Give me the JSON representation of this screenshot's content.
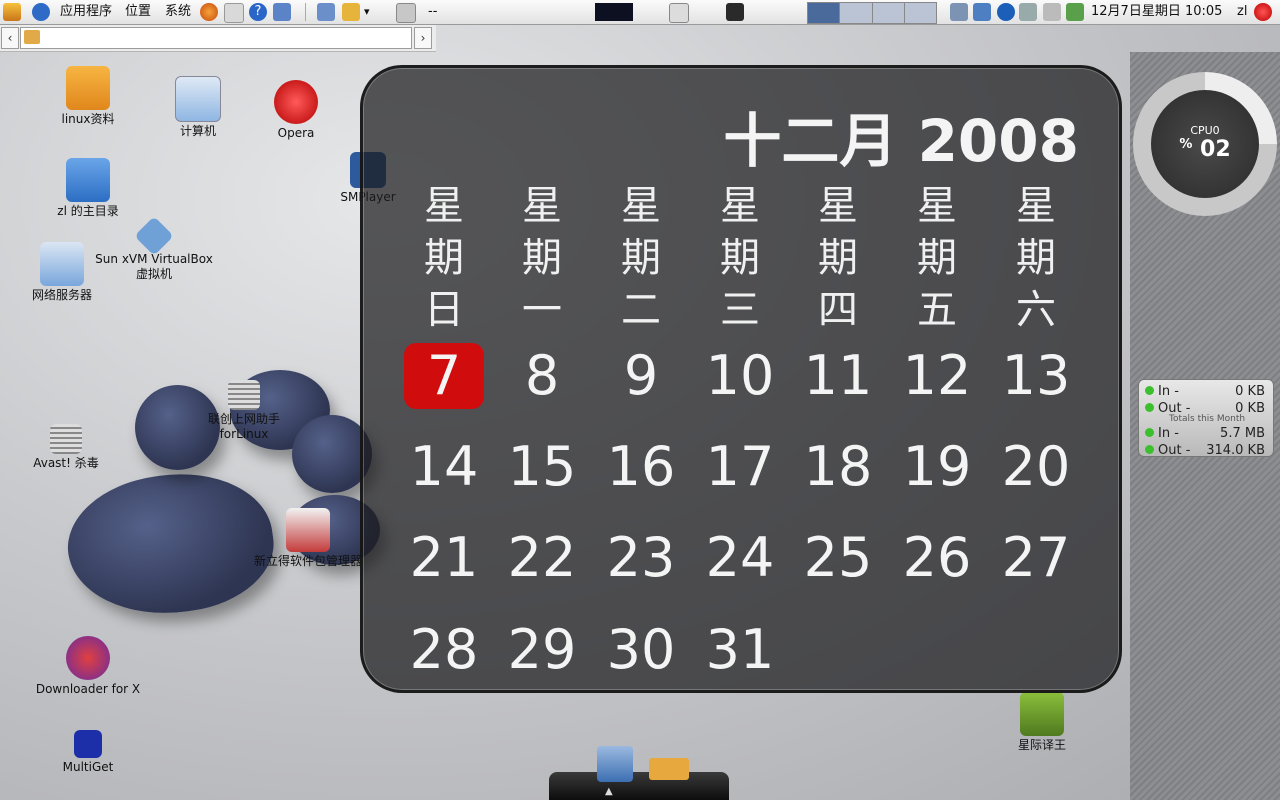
{
  "panel": {
    "menu_apps": "应用程序",
    "menu_places": "位置",
    "menu_system": "系统",
    "dashes": "--",
    "clock": "12月7日星期日 10:05",
    "user": "zl"
  },
  "desktop_icons": {
    "linux_docs": "linux资料",
    "computer": "计算机",
    "opera": "Opera",
    "smplayer": "SMPlayer",
    "home": "zl 的主目录",
    "virtualbox_line1": "Sun xVM VirtualBox",
    "virtualbox_line2": "虚拟机",
    "network": "网络服务器",
    "lianchuang": "联创上网助手forLinux",
    "avast": "Avast! 杀毒",
    "synaptic": "新立得软件包管理器",
    "downloader": "Downloader for X",
    "multiget": "MultiGet",
    "xingji": "星际译王"
  },
  "calendar": {
    "title": "十二月 2008",
    "weekdays": [
      "星期日",
      "星期一",
      "星期二",
      "星期三",
      "星期四",
      "星期五",
      "星期六"
    ],
    "today": "7",
    "days": [
      "7",
      "8",
      "9",
      "10",
      "11",
      "12",
      "13",
      "14",
      "15",
      "16",
      "17",
      "18",
      "19",
      "20",
      "21",
      "22",
      "23",
      "24",
      "25",
      "26",
      "27",
      "28",
      "29",
      "30",
      "31"
    ]
  },
  "cpu": {
    "label": "CPU0",
    "unit": "%",
    "value": "02"
  },
  "network": {
    "in_label": "In -",
    "in_value": "0 KB",
    "out_label": "Out -",
    "out_value": "0 KB",
    "totals_label": "Totals this Month",
    "month_in_label": "In -",
    "month_in_value": "5.7 MB",
    "month_out_label": "Out -",
    "month_out_value": "314.0 KB"
  }
}
